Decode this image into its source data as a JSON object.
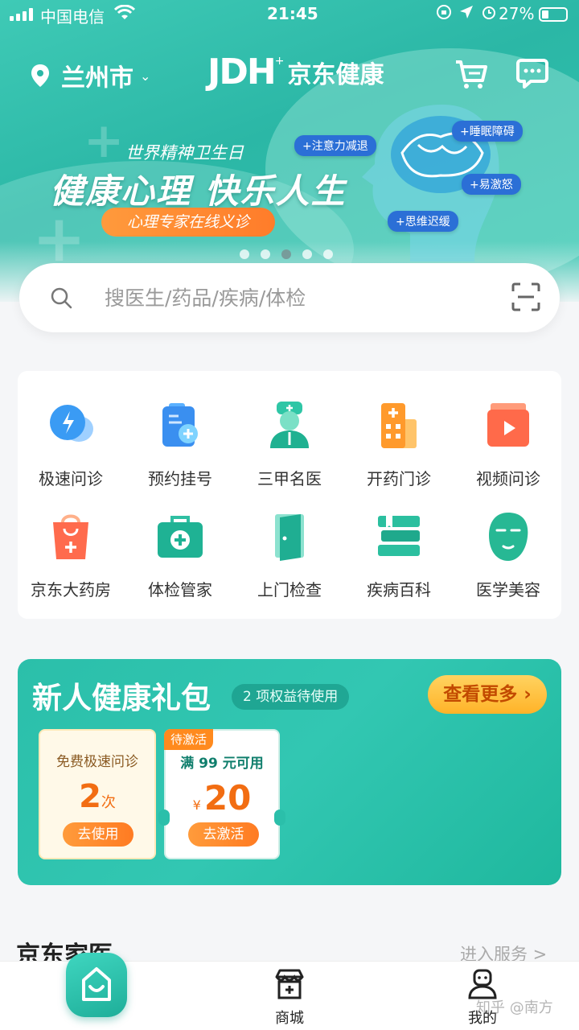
{
  "status_bar": {
    "carrier": "中国电信",
    "time": "21:45",
    "battery": "27%"
  },
  "header": {
    "location": "兰州市",
    "logo_mark": "JDH",
    "logo_name": "京东健康"
  },
  "banner": {
    "subtitle": "世界精神卫生日",
    "title": "健康心理 快乐人生",
    "button": "心理专家在线义诊",
    "tags": [
      "+注意力减退",
      "+睡眠障碍",
      "+易激怒",
      "+思维迟缓"
    ],
    "active_dot": 3,
    "dot_count": 5
  },
  "search": {
    "placeholder": "搜医生/药品/疾病/体检"
  },
  "services": [
    {
      "label": "极速问诊",
      "icon": "lightning-chat-icon"
    },
    {
      "label": "预约挂号",
      "icon": "register-card-icon"
    },
    {
      "label": "三甲名医",
      "icon": "doctor-icon"
    },
    {
      "label": "开药门诊",
      "icon": "hospital-icon"
    },
    {
      "label": "视频问诊",
      "icon": "video-icon"
    },
    {
      "label": "京东大药房",
      "icon": "pharmacy-bag-icon"
    },
    {
      "label": "体检管家",
      "icon": "medical-kit-icon"
    },
    {
      "label": "上门检查",
      "icon": "door-icon"
    },
    {
      "label": "疾病百科",
      "icon": "books-icon"
    },
    {
      "label": "医学美容",
      "icon": "face-mask-icon"
    }
  ],
  "gift": {
    "title": "新人健康礼包",
    "badge": "2 项权益待使用",
    "more": "查看更多",
    "coupon1": {
      "title": "免费极速问诊",
      "count": "2",
      "unit": "次",
      "button": "去使用"
    },
    "coupon2": {
      "tag": "待激活",
      "title": "满 99 元可用",
      "currency": "¥",
      "amount": "20",
      "button": "去激活"
    }
  },
  "section": {
    "title": "京东家医",
    "link": "进入服务 >"
  },
  "tabbar": {
    "mall": "商城",
    "mine": "我的"
  },
  "watermark": "知乎 @南方",
  "colors": {
    "brand": "#2bb7a6",
    "accent_orange": "#ff7c2a"
  }
}
